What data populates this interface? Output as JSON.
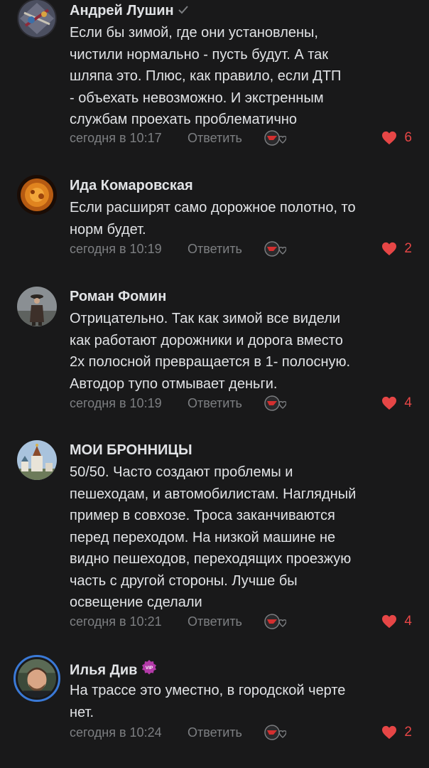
{
  "colors": {
    "background": "#19191a",
    "text_primary": "#e1e3e6",
    "text_secondary": "#7d7f82",
    "like_accent": "#e64646",
    "story_ring": "#3a79d6"
  },
  "comments": [
    {
      "author": "Андрей Лушин",
      "badge_icon": "verified-check-icon",
      "lines": [
        "Если бы зимой, где они установлены,",
        "чистили нормально - пусть будут. А так",
        "шляпа это. Плюс, как правило, если ДТП",
        "- объехать невозможно. И экстренным",
        "службам проехать проблематично"
      ],
      "time": "сегодня в 10:17",
      "reply_label": "Ответить",
      "likes": "6"
    },
    {
      "author": "Ида Комаровская",
      "lines": [
        "Если расширят само дорожное полотно, то",
        "норм будет."
      ],
      "time": "сегодня в 10:19",
      "reply_label": "Ответить",
      "likes": "2"
    },
    {
      "author": "Роман Фомин",
      "lines": [
        "Отрицательно. Так как зимой все видели",
        "как работают дорожники и дорога вместо",
        "2х полосной превращается в 1- полосную.",
        "Автодор тупо отмывает деньги."
      ],
      "time": "сегодня в 10:19",
      "reply_label": "Ответить",
      "likes": "4"
    },
    {
      "author": "МОИ БРОННИЦЫ",
      "lines": [
        "50/50. Часто создают проблемы и",
        "пешеходам, и автомобилистам. Наглядный",
        "пример в совхозе. Троса заканчиваются",
        "перед переходом. На низкой машине не",
        "видно пешеходов, переходящих проезжую",
        "часть с другой стороны. Лучше бы",
        "освещение сделали"
      ],
      "time": "сегодня в 10:21",
      "reply_label": "Ответить",
      "likes": "4"
    },
    {
      "author": "Илья Див",
      "badge_icon": "vip-badge-icon",
      "badge_text": "VIP",
      "lines": [
        "На трассе это уместно, в городской черте",
        "нет."
      ],
      "time": "сегодня в 10:24",
      "reply_label": "Ответить",
      "likes": "2"
    }
  ]
}
